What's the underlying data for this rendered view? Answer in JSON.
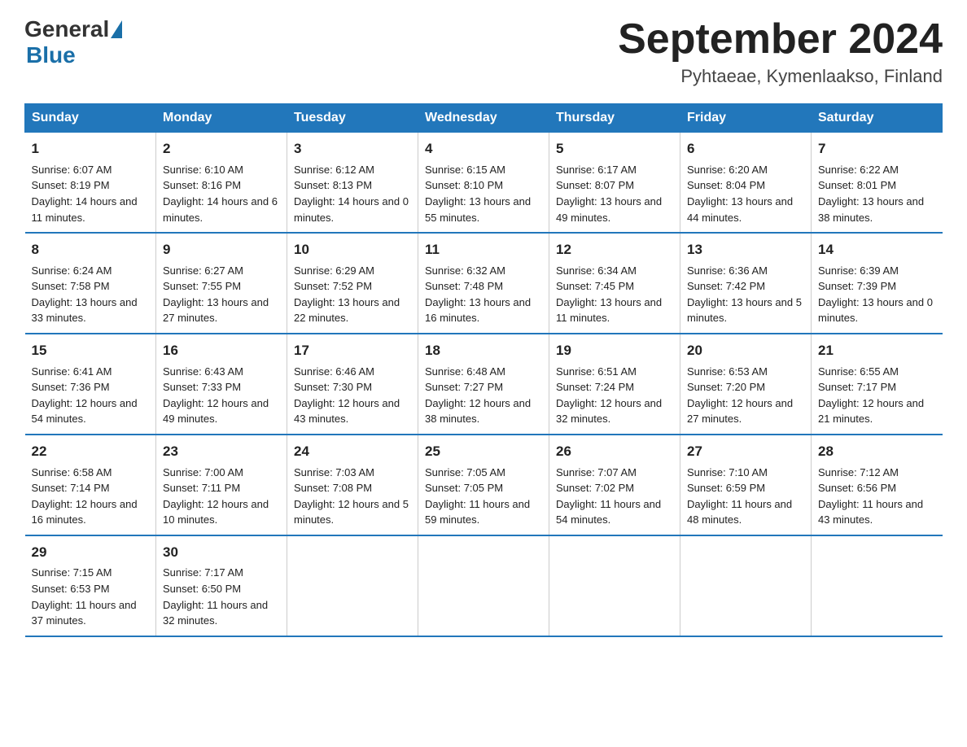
{
  "logo": {
    "general": "General",
    "blue": "Blue"
  },
  "title": "September 2024",
  "location": "Pyhtaeae, Kymenlaakso, Finland",
  "headers": [
    "Sunday",
    "Monday",
    "Tuesday",
    "Wednesday",
    "Thursday",
    "Friday",
    "Saturday"
  ],
  "weeks": [
    [
      {
        "day": "1",
        "sunrise": "6:07 AM",
        "sunset": "8:19 PM",
        "daylight": "14 hours and 11 minutes."
      },
      {
        "day": "2",
        "sunrise": "6:10 AM",
        "sunset": "8:16 PM",
        "daylight": "14 hours and 6 minutes."
      },
      {
        "day": "3",
        "sunrise": "6:12 AM",
        "sunset": "8:13 PM",
        "daylight": "14 hours and 0 minutes."
      },
      {
        "day": "4",
        "sunrise": "6:15 AM",
        "sunset": "8:10 PM",
        "daylight": "13 hours and 55 minutes."
      },
      {
        "day": "5",
        "sunrise": "6:17 AM",
        "sunset": "8:07 PM",
        "daylight": "13 hours and 49 minutes."
      },
      {
        "day": "6",
        "sunrise": "6:20 AM",
        "sunset": "8:04 PM",
        "daylight": "13 hours and 44 minutes."
      },
      {
        "day": "7",
        "sunrise": "6:22 AM",
        "sunset": "8:01 PM",
        "daylight": "13 hours and 38 minutes."
      }
    ],
    [
      {
        "day": "8",
        "sunrise": "6:24 AM",
        "sunset": "7:58 PM",
        "daylight": "13 hours and 33 minutes."
      },
      {
        "day": "9",
        "sunrise": "6:27 AM",
        "sunset": "7:55 PM",
        "daylight": "13 hours and 27 minutes."
      },
      {
        "day": "10",
        "sunrise": "6:29 AM",
        "sunset": "7:52 PM",
        "daylight": "13 hours and 22 minutes."
      },
      {
        "day": "11",
        "sunrise": "6:32 AM",
        "sunset": "7:48 PM",
        "daylight": "13 hours and 16 minutes."
      },
      {
        "day": "12",
        "sunrise": "6:34 AM",
        "sunset": "7:45 PM",
        "daylight": "13 hours and 11 minutes."
      },
      {
        "day": "13",
        "sunrise": "6:36 AM",
        "sunset": "7:42 PM",
        "daylight": "13 hours and 5 minutes."
      },
      {
        "day": "14",
        "sunrise": "6:39 AM",
        "sunset": "7:39 PM",
        "daylight": "13 hours and 0 minutes."
      }
    ],
    [
      {
        "day": "15",
        "sunrise": "6:41 AM",
        "sunset": "7:36 PM",
        "daylight": "12 hours and 54 minutes."
      },
      {
        "day": "16",
        "sunrise": "6:43 AM",
        "sunset": "7:33 PM",
        "daylight": "12 hours and 49 minutes."
      },
      {
        "day": "17",
        "sunrise": "6:46 AM",
        "sunset": "7:30 PM",
        "daylight": "12 hours and 43 minutes."
      },
      {
        "day": "18",
        "sunrise": "6:48 AM",
        "sunset": "7:27 PM",
        "daylight": "12 hours and 38 minutes."
      },
      {
        "day": "19",
        "sunrise": "6:51 AM",
        "sunset": "7:24 PM",
        "daylight": "12 hours and 32 minutes."
      },
      {
        "day": "20",
        "sunrise": "6:53 AM",
        "sunset": "7:20 PM",
        "daylight": "12 hours and 27 minutes."
      },
      {
        "day": "21",
        "sunrise": "6:55 AM",
        "sunset": "7:17 PM",
        "daylight": "12 hours and 21 minutes."
      }
    ],
    [
      {
        "day": "22",
        "sunrise": "6:58 AM",
        "sunset": "7:14 PM",
        "daylight": "12 hours and 16 minutes."
      },
      {
        "day": "23",
        "sunrise": "7:00 AM",
        "sunset": "7:11 PM",
        "daylight": "12 hours and 10 minutes."
      },
      {
        "day": "24",
        "sunrise": "7:03 AM",
        "sunset": "7:08 PM",
        "daylight": "12 hours and 5 minutes."
      },
      {
        "day": "25",
        "sunrise": "7:05 AM",
        "sunset": "7:05 PM",
        "daylight": "11 hours and 59 minutes."
      },
      {
        "day": "26",
        "sunrise": "7:07 AM",
        "sunset": "7:02 PM",
        "daylight": "11 hours and 54 minutes."
      },
      {
        "day": "27",
        "sunrise": "7:10 AM",
        "sunset": "6:59 PM",
        "daylight": "11 hours and 48 minutes."
      },
      {
        "day": "28",
        "sunrise": "7:12 AM",
        "sunset": "6:56 PM",
        "daylight": "11 hours and 43 minutes."
      }
    ],
    [
      {
        "day": "29",
        "sunrise": "7:15 AM",
        "sunset": "6:53 PM",
        "daylight": "11 hours and 37 minutes."
      },
      {
        "day": "30",
        "sunrise": "7:17 AM",
        "sunset": "6:50 PM",
        "daylight": "11 hours and 32 minutes."
      },
      null,
      null,
      null,
      null,
      null
    ]
  ]
}
